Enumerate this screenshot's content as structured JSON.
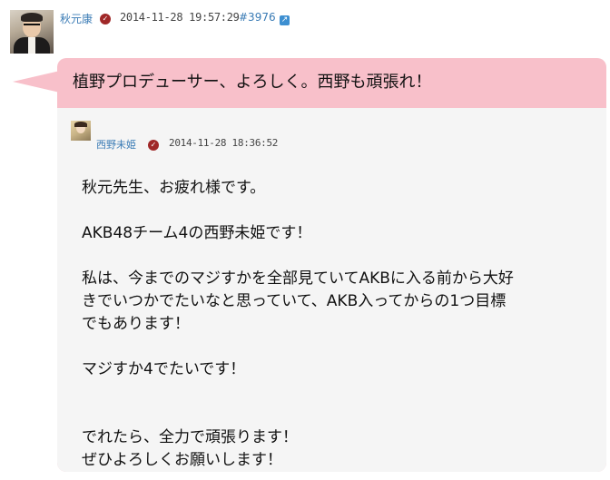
{
  "post": {
    "author": "秋元康",
    "timestamp": "2014-11-28 19:57:29",
    "message_number": "#3976",
    "message": "植野プロデューサー、よろしく。西野も頑張れ！"
  },
  "quoted": {
    "author": "西野未姫",
    "timestamp": "2014-11-28 18:36:52",
    "body": "秋元先生、お疲れ様です。\n\nAKB48チーム4の西野未姫です！\n\n私は、今までのマジすかを全部見ていてAKBに入る前から大好\nきでいつかでたいなと思っていて、AKB入ってからの1つ目標\nでもあります！\n\nマジすか4でたいです！\n\n\nでれたら、全力で頑張ります！\nぜひよろしくお願いします！"
  },
  "colors": {
    "bubble": "#f8c0ca",
    "quote_background": "#f5f5f5",
    "link": "#3a7bb5",
    "verified_badge": "#a02828"
  },
  "icons": {
    "verified": "verified-badge-icon",
    "external_link": "external-link-icon"
  }
}
